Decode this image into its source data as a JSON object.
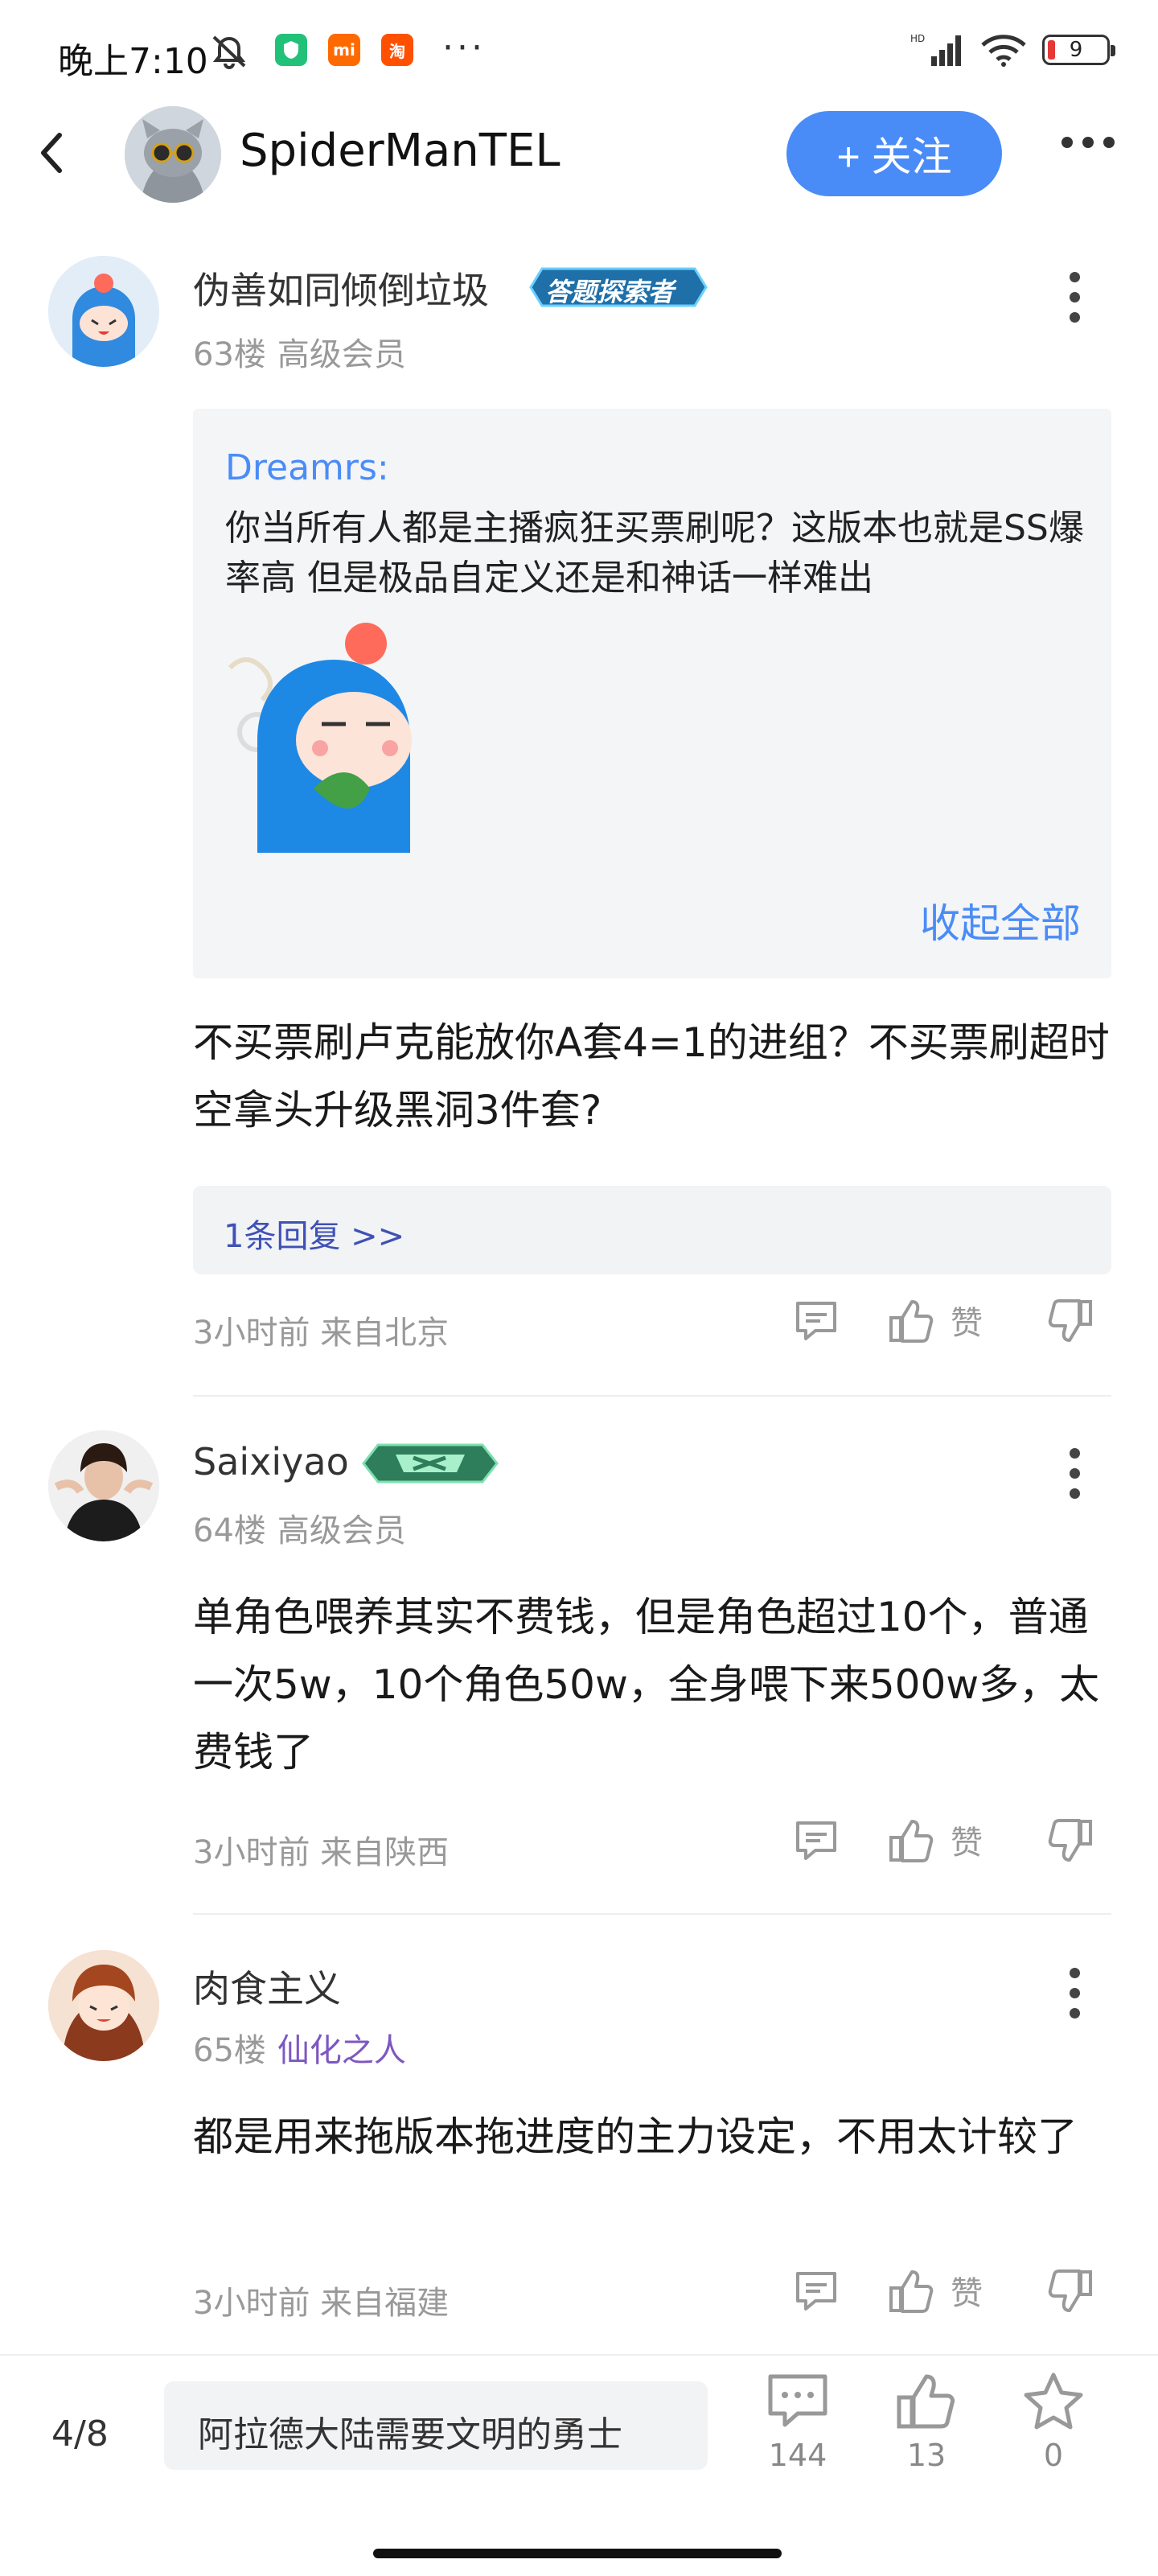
{
  "status_bar": {
    "time": "晚上7:10",
    "battery": "9",
    "dots": "···",
    "app_xiaomi": "mi",
    "app_taobao": "淘"
  },
  "header": {
    "title": "SpiderManTEL",
    "follow_label": "+ 关注"
  },
  "comments": [
    {
      "user": "伪善如同倾倒垃圾",
      "badge": "答题探索者",
      "floor": "63楼",
      "level": "高级会员",
      "quote": {
        "author": "Dreamrs:",
        "text": "你当所有人都是主播疯狂买票刷呢？这版本也就是SS爆率高 但是极品自定义还是和神话一样难出",
        "collapse_label": "收起全部"
      },
      "text": "不买票刷卢克能放你A套4=1的进组？不买票刷超时空拿头升级黑洞3件套?",
      "replies_label": "1条回复 >>",
      "time": "3小时前",
      "location": "来自北京",
      "like_label": "赞"
    },
    {
      "user": "Saixiyao",
      "badge": "",
      "floor": "64楼",
      "level": "高级会员",
      "text": "单角色喂养其实不费钱，但是角色超过10个，普通一次5w，10个角色50w，全身喂下来500w多，太费钱了",
      "time": "3小时前",
      "location": "来自陕西",
      "like_label": "赞"
    },
    {
      "user": "肉食主义",
      "floor": "65楼",
      "level": "仙化之人",
      "level_color": "#7e57c2",
      "text": "都是用来拖版本拖进度的主力设定，不用太计较了",
      "time": "3小时前",
      "location": "来自福建",
      "like_label": "赞"
    }
  ],
  "bottom_bar": {
    "page_indicator": "4/8",
    "input_text": "阿拉德大陆需要文明的勇士",
    "comments_count": "144",
    "likes_count": "13",
    "favorites_count": "0"
  },
  "colors": {
    "accent": "#4a8cf7",
    "reply_link": "#3f51b5",
    "meta": "#999999"
  }
}
